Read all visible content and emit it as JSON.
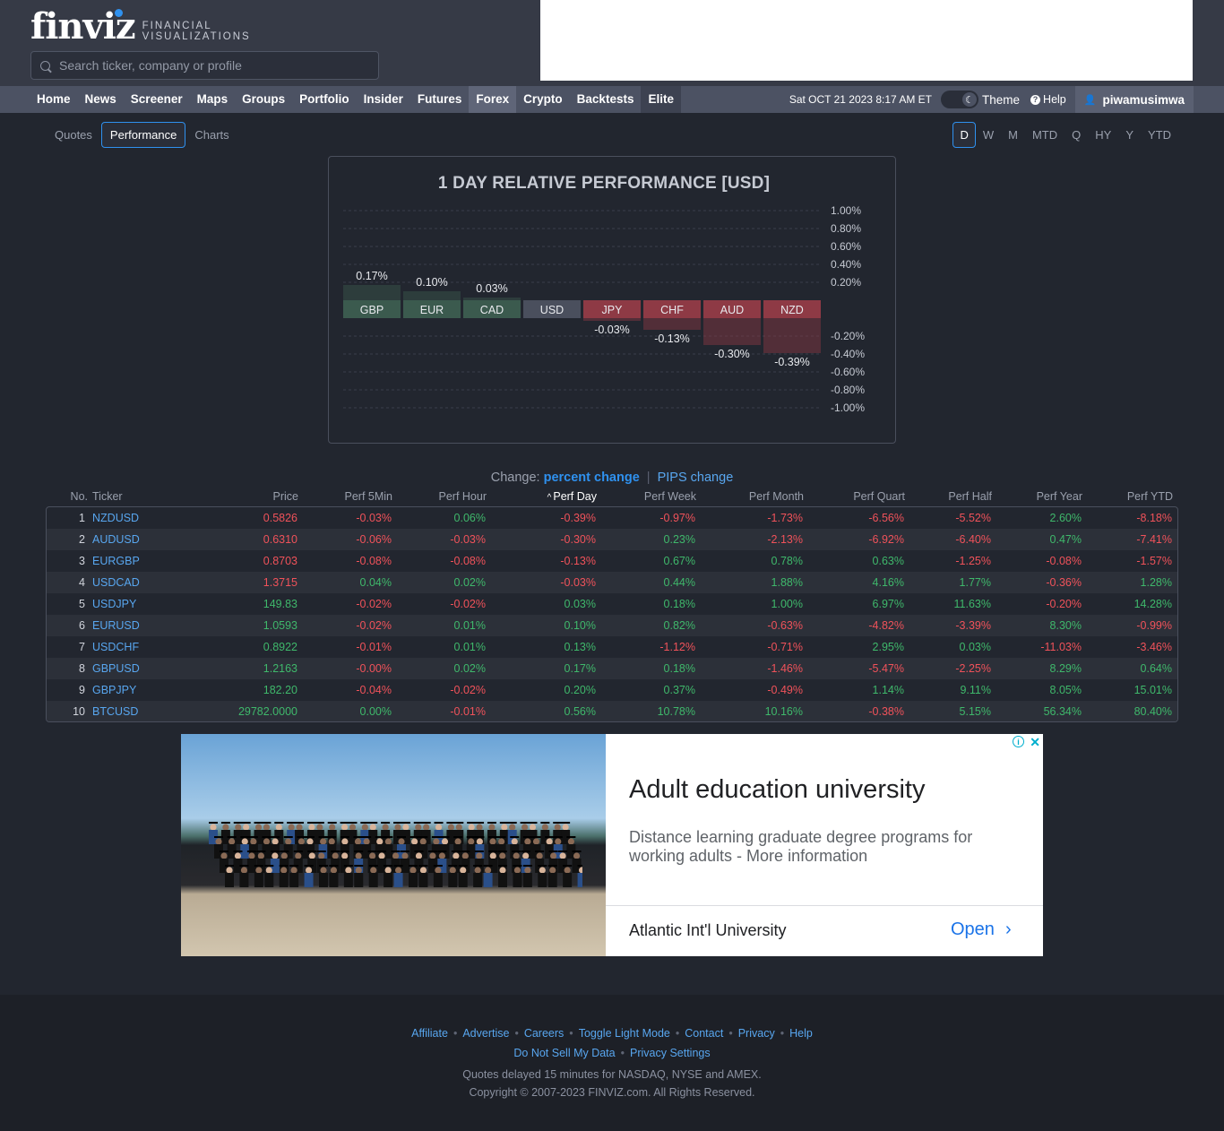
{
  "header": {
    "logo_text": "finviz",
    "logo_sub_line1": "FINANCIAL",
    "logo_sub_line2": "VISUALIZATIONS",
    "search_placeholder": "Search ticker, company or profile"
  },
  "nav": {
    "items": [
      "Home",
      "News",
      "Screener",
      "Maps",
      "Groups",
      "Portfolio",
      "Insider",
      "Futures",
      "Forex",
      "Crypto",
      "Backtests",
      "Elite"
    ],
    "active": "Forex",
    "datetime": "Sat OCT 21 2023 8:17 AM ET",
    "theme_label": "Theme",
    "help_label": "Help",
    "user": "piwamusimwa"
  },
  "subtabs": [
    "Quotes",
    "Performance",
    "Charts"
  ],
  "subtab_active": "Performance",
  "periods": [
    "D",
    "W",
    "M",
    "MTD",
    "Q",
    "HY",
    "Y",
    "YTD"
  ],
  "period_active": "D",
  "chart_data": {
    "type": "bar",
    "title": "1 DAY RELATIVE PERFORMANCE  [USD]",
    "categories": [
      "GBP",
      "EUR",
      "CAD",
      "USD",
      "JPY",
      "CHF",
      "AUD",
      "NZD"
    ],
    "values": [
      0.17,
      0.1,
      0.03,
      0.0,
      -0.03,
      -0.13,
      -0.3,
      -0.39
    ],
    "value_labels": [
      "0.17%",
      "0.10%",
      "0.03%",
      "",
      "-0.03%",
      "-0.13%",
      "-0.30%",
      "-0.39%"
    ],
    "ylim": [
      -1.0,
      1.0
    ],
    "yticks_top": [
      "1.00%",
      "0.80%",
      "0.60%",
      "0.40%",
      "0.20%"
    ],
    "yticks_bottom": [
      "-0.20%",
      "-0.40%",
      "-0.60%",
      "-0.80%",
      "-1.00%"
    ],
    "grid": true,
    "colors": {
      "positive": "#3b5a4e",
      "neutral": "#4a4f5d",
      "negative": "#8e3a45"
    }
  },
  "change_toggle": {
    "label": "Change:",
    "percent": "percent change",
    "pips": "PIPS change"
  },
  "table": {
    "columns": [
      "No.",
      "Ticker",
      "Price",
      "Perf 5Min",
      "Perf Hour",
      "Perf Day",
      "Perf Week",
      "Perf Month",
      "Perf Quart",
      "Perf Half",
      "Perf Year",
      "Perf YTD"
    ],
    "sorted_column": "Perf Day",
    "rows": [
      {
        "no": "1",
        "ticker": "NZDUSD",
        "price": "0.5826",
        "p5": "-0.03%",
        "ph": "0.06%",
        "pd": "-0.39%",
        "pw": "-0.97%",
        "pm": "-1.73%",
        "pq": "-6.56%",
        "phy": "-5.52%",
        "py": "2.60%",
        "pytd": "-8.18%"
      },
      {
        "no": "2",
        "ticker": "AUDUSD",
        "price": "0.6310",
        "p5": "-0.06%",
        "ph": "-0.03%",
        "pd": "-0.30%",
        "pw": "0.23%",
        "pm": "-2.13%",
        "pq": "-6.92%",
        "phy": "-6.40%",
        "py": "0.47%",
        "pytd": "-7.41%"
      },
      {
        "no": "3",
        "ticker": "EURGBP",
        "price": "0.8703",
        "p5": "-0.08%",
        "ph": "-0.08%",
        "pd": "-0.13%",
        "pw": "0.67%",
        "pm": "0.78%",
        "pq": "0.63%",
        "phy": "-1.25%",
        "py": "-0.08%",
        "pytd": "-1.57%"
      },
      {
        "no": "4",
        "ticker": "USDCAD",
        "price": "1.3715",
        "p5": "0.04%",
        "ph": "0.02%",
        "pd": "-0.03%",
        "pw": "0.44%",
        "pm": "1.88%",
        "pq": "4.16%",
        "phy": "1.77%",
        "py": "-0.36%",
        "pytd": "1.28%"
      },
      {
        "no": "5",
        "ticker": "USDJPY",
        "price": "149.83",
        "p5": "-0.02%",
        "ph": "-0.02%",
        "pd": "0.03%",
        "pw": "0.18%",
        "pm": "1.00%",
        "pq": "6.97%",
        "phy": "11.63%",
        "py": "-0.20%",
        "pytd": "14.28%"
      },
      {
        "no": "6",
        "ticker": "EURUSD",
        "price": "1.0593",
        "p5": "-0.02%",
        "ph": "0.01%",
        "pd": "0.10%",
        "pw": "0.82%",
        "pm": "-0.63%",
        "pq": "-4.82%",
        "phy": "-3.39%",
        "py": "8.30%",
        "pytd": "-0.99%"
      },
      {
        "no": "7",
        "ticker": "USDCHF",
        "price": "0.8922",
        "p5": "-0.01%",
        "ph": "0.01%",
        "pd": "0.13%",
        "pw": "-1.12%",
        "pm": "-0.71%",
        "pq": "2.95%",
        "phy": "0.03%",
        "py": "-11.03%",
        "pytd": "-3.46%"
      },
      {
        "no": "8",
        "ticker": "GBPUSD",
        "price": "1.2163",
        "p5": "-0.00%",
        "ph": "0.02%",
        "pd": "0.17%",
        "pw": "0.18%",
        "pm": "-1.46%",
        "pq": "-5.47%",
        "phy": "-2.25%",
        "py": "8.29%",
        "pytd": "0.64%"
      },
      {
        "no": "9",
        "ticker": "GBPJPY",
        "price": "182.20",
        "p5": "-0.04%",
        "ph": "-0.02%",
        "pd": "0.20%",
        "pw": "0.37%",
        "pm": "-0.49%",
        "pq": "1.14%",
        "phy": "9.11%",
        "py": "8.05%",
        "pytd": "15.01%"
      },
      {
        "no": "10",
        "ticker": "BTCUSD",
        "price": "29782.0000",
        "p5": "0.00%",
        "ph": "-0.01%",
        "pd": "0.56%",
        "pw": "10.78%",
        "pm": "10.16%",
        "pq": "-0.38%",
        "phy": "5.15%",
        "py": "56.34%",
        "pytd": "80.40%"
      }
    ],
    "price_colors": [
      "neg",
      "neg",
      "neg",
      "neg",
      "pos",
      "pos",
      "pos",
      "pos",
      "pos",
      "pos"
    ]
  },
  "ad": {
    "headline": "Adult education university",
    "description": "Distance learning graduate degree programs for working adults - More information",
    "advertiser": "Atlantic Int'l University",
    "cta": "Open"
  },
  "footer": {
    "links_row1": [
      "Affiliate",
      "Advertise",
      "Careers",
      "Toggle Light Mode",
      "Contact",
      "Privacy",
      "Help"
    ],
    "links_row2": [
      "Do Not Sell My Data",
      "Privacy Settings"
    ],
    "note1": "Quotes delayed 15 minutes for NASDAQ, NYSE and AMEX.",
    "note2": "Copyright © 2007-2023 FINVIZ.com. All Rights Reserved."
  }
}
